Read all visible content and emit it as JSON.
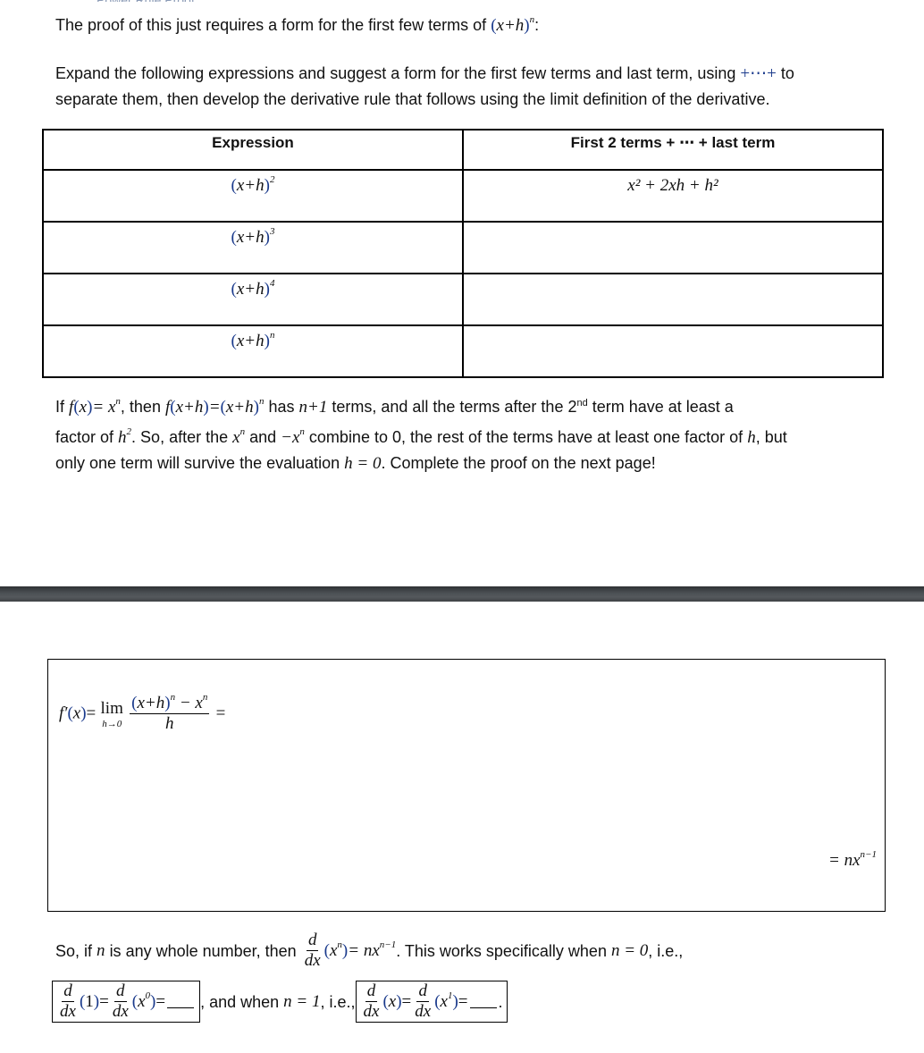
{
  "header": {
    "cutoff_heading": "Power Rule Proof",
    "intro": "The proof of this just requires a form for the first few terms of",
    "intro_expr_base": "x+h",
    "intro_expr_exp": "n",
    "intro_end": ":"
  },
  "instructions": {
    "line1_a": "Expand the following expressions and suggest a form for the first few terms and last term, using",
    "line1_sep": "+⋯+",
    "line1_b": "to",
    "line2": "separate them, then develop the derivative rule that follows using the limit definition of the derivative."
  },
  "table": {
    "headers": [
      "Expression",
      "First 2 terms + ⋯ + last term"
    ],
    "rows": [
      {
        "base": "x+h",
        "exp": "2",
        "answer": "x² + 2xh + h²"
      },
      {
        "base": "x+h",
        "exp": "3",
        "answer": ""
      },
      {
        "base": "x+h",
        "exp": "4",
        "answer": ""
      },
      {
        "base": "x+h",
        "exp": "n",
        "answer": ""
      }
    ]
  },
  "explanation": {
    "l1_a": "If",
    "l1_f": "f",
    "l1_x": "x",
    "l1_eq": "= x",
    "l1_then": ", then",
    "l1_fxh": "x+h",
    "l1_has": "has",
    "l1_n1": "n+1",
    "l1_rest": "terms, and all the terms after the 2",
    "l1_nd": "nd",
    "l1_end": "term have at least a",
    "l2_a": "factor of",
    "l2_h": "h",
    "l2_b": ". So, after the",
    "l2_and": "and",
    "l2_neg": "−x",
    "l2_c": "combine to 0, the rest of the terms have at least one factor of",
    "l2_d": ", but",
    "l3_a": "only one term will survive the evaluation",
    "l3_eval": "h = 0",
    "l3_b": ". Complete the proof on the next page!"
  },
  "proof_box": {
    "lhs": "f′",
    "lhs_arg": "x",
    "lim": "lim",
    "lim_sub": "h→0",
    "num_base": "x+h",
    "num_rest": "− x",
    "den": "h",
    "eq": "=",
    "result": "= nx",
    "result_exp": "n−1"
  },
  "conclusion": {
    "l1_a": "So, if",
    "l1_n": "n",
    "l1_b": "is any whole number, then",
    "d": "d",
    "dx": "dx",
    "l1_rhs": "= nx",
    "l1_rhs_exp": "n−1",
    "l1_c": ". This works specifically when",
    "l1_n0": "n = 0",
    "l1_ie": ", i.e.,",
    "box1_arg1": "1",
    "box1_arg2": "x",
    "box1_exp": "0",
    "mid": ", and when",
    "mid_n1": "n = 1",
    "mid_ie": ", i.e.,",
    "box2_arg1": "x",
    "box2_arg2": "x",
    "box2_exp": "1",
    "end": "."
  }
}
